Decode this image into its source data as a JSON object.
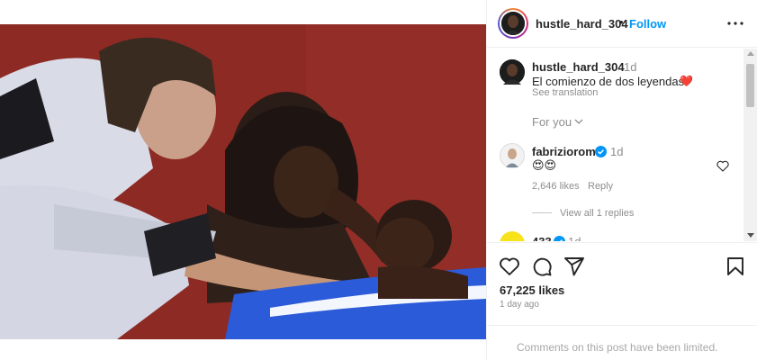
{
  "post": {
    "username": "hustle_hard_304",
    "follow_label": "Follow",
    "separator": "•"
  },
  "caption": {
    "username": "hustle_hard_304",
    "time": "1d",
    "text": "El comienzo de dos leyendas",
    "heart_emoji": "❤️",
    "see_translation": "See translation"
  },
  "for_you": {
    "label": "For you"
  },
  "comments": [
    {
      "username": "fabriziorom",
      "verified": true,
      "time": "1d",
      "text": "😍😍",
      "likes": "2,646 likes",
      "reply_label": "Reply",
      "view_replies": "View all 1 replies"
    },
    {
      "username": "433",
      "verified": true,
      "time": "1d"
    }
  ],
  "stats": {
    "likes": "67,225 likes",
    "time_ago": "1 day ago"
  },
  "footer": {
    "text": "Comments on this post have been limited."
  },
  "colors": {
    "follow_blue": "#0095f6",
    "verified_blue": "#0095f6",
    "heart_red": "#ed1c24",
    "photo_backdrop": "#8d2a24",
    "tub_blue": "#2b5bd8"
  },
  "icons": [
    "more-options-icon",
    "like-heart-icon",
    "comment-icon",
    "share-icon",
    "save-bookmark-icon",
    "verified-badge-icon",
    "chevron-down-icon",
    "small-heart-icon"
  ]
}
